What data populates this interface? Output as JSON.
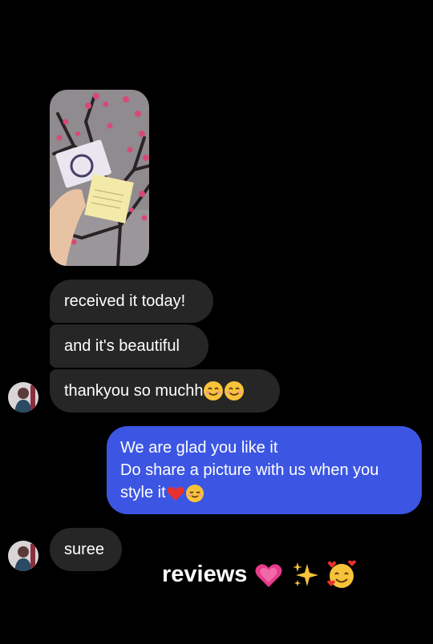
{
  "conversation": {
    "shared_photo": {
      "label": "shared-product-photo"
    },
    "messages": [
      {
        "sender": "customer",
        "text": "received it today!"
      },
      {
        "sender": "customer",
        "text": "and it's beautiful"
      },
      {
        "sender": "customer",
        "text": "thankyou so muchh"
      },
      {
        "sender": "shop",
        "lines": [
          "We are glad you like it",
          "Do share a picture with us when you",
          "style it"
        ]
      },
      {
        "sender": "customer",
        "text": "suree"
      }
    ],
    "emojis": {
      "thanks": [
        "smiling-face-icon",
        "smiling-face-icon"
      ],
      "shop_reply": [
        "red-heart-icon",
        "relieved-face-icon"
      ],
      "caption": [
        "sparkling-heart-icon",
        "sparkles-icon",
        "smiling-face-with-hearts-icon"
      ]
    }
  },
  "caption": {
    "text": "reviews"
  },
  "colors": {
    "background": "#000000",
    "incoming_bubble": "#262626",
    "outgoing_bubble": "#3c56e3",
    "text": "#ffffff"
  }
}
